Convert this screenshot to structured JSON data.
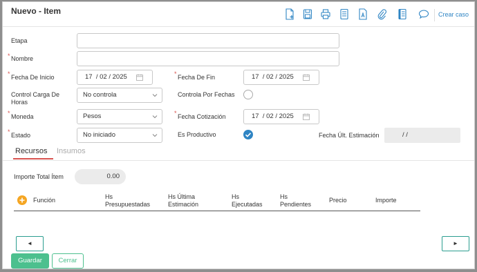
{
  "header": {
    "title": "Nuevo - Item",
    "crear_caso": "Crear caso"
  },
  "toolbar": {
    "icons": [
      "new-document-icon",
      "save-icon",
      "print-icon",
      "document-list-icon",
      "text-document-icon",
      "attach-icon",
      "notebook-icon",
      "comment-icon"
    ],
    "accent_color": "#2f85c4"
  },
  "form": {
    "etapa": {
      "label": "Etapa",
      "value": ""
    },
    "nombre": {
      "label": "Nombre",
      "value": "",
      "required": "*"
    },
    "fecha_inicio": {
      "label": "Fecha De Inicio",
      "day": "17",
      "month": "02",
      "year": "2025",
      "required": "*"
    },
    "fecha_fin": {
      "label": "Fecha De Fin",
      "day": "17",
      "month": "02",
      "year": "2025",
      "required": "*"
    },
    "control_carga_horas": {
      "label_line1": "Control Carga De",
      "label_line2": "Horas",
      "value": "No controla"
    },
    "controla_por_fechas": {
      "label": "Controla Por Fechas",
      "checked": false
    },
    "moneda": {
      "label": "Moneda",
      "value": "Pesos",
      "required": "*"
    },
    "fecha_cotizacion": {
      "label": "Fecha Cotización",
      "day": "17",
      "month": "02",
      "year": "2025",
      "required": "*"
    },
    "estado": {
      "label": "Estado",
      "value": "No iniciado",
      "required": "*"
    },
    "es_productivo": {
      "label": "Es Productivo",
      "checked": true
    },
    "fecha_ult_estimacion": {
      "label": "Fecha Últ. Estimación",
      "value": "/       /"
    }
  },
  "tabs": [
    {
      "label": "Recursos",
      "active": true
    },
    {
      "label": "Insumos",
      "active": false
    }
  ],
  "recursos": {
    "importe_total_label": "Importe Total Ítem",
    "importe_total_value": "0.00",
    "columns": [
      {
        "line1": "Función",
        "line2": ""
      },
      {
        "line1": "Hs",
        "line2": "Presupuestadas"
      },
      {
        "line1": "Hs Última",
        "line2": "Estimación"
      },
      {
        "line1": "Hs",
        "line2": "Ejecutadas"
      },
      {
        "line1": "Hs",
        "line2": "Pendientes"
      },
      {
        "line1": "Precio",
        "line2": ""
      },
      {
        "line1": "Importe",
        "line2": ""
      }
    ]
  },
  "pagination": {
    "prev": "◄",
    "next": "►"
  },
  "actions": {
    "save": "Guardar",
    "close": "Cerrar",
    "save_color": "#4cc08e"
  }
}
